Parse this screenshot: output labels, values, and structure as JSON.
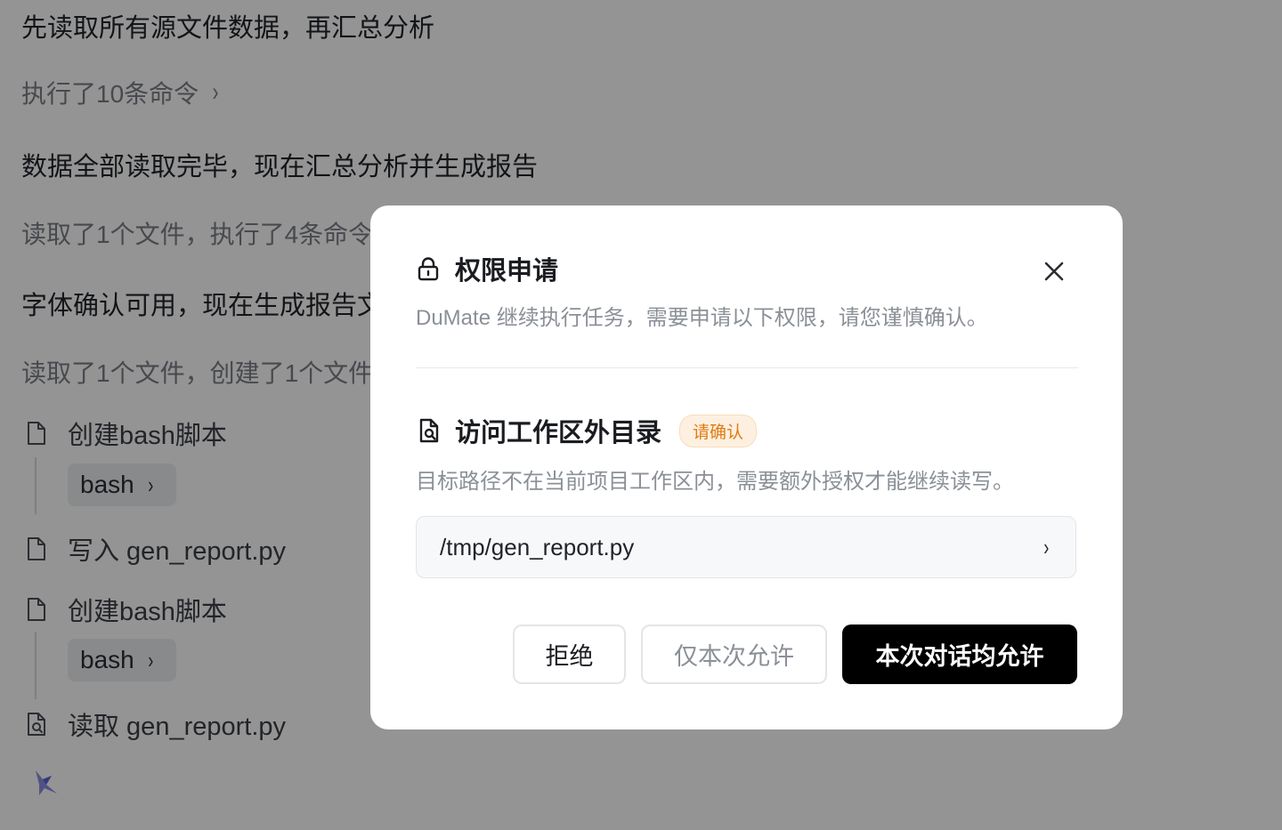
{
  "chat": {
    "msg1": "先读取所有源文件数据，再汇总分析",
    "summary1": "执行了10条命令",
    "msg2": "数据全部读取完毕，现在汇总分析并生成报告",
    "summary2": "读取了1个文件，执行了4条命令",
    "msg3": "字体确认可用，现在生成报告文",
    "summary3": "读取了1个文件，创建了1个文件",
    "steps": [
      {
        "label": "创建bash脚本",
        "tool": "bash"
      },
      {
        "label": "写入 gen_report.py"
      },
      {
        "label": "创建bash脚本",
        "tool": "bash"
      },
      {
        "label": "读取 gen_report.py"
      }
    ],
    "chevron": "›"
  },
  "modal": {
    "title": "权限申请",
    "description": "DuMate 继续执行任务，需要申请以下权限，请您谨慎确认。",
    "section": {
      "title": "访问工作区外目录",
      "badge": "请确认",
      "description": "目标路径不在当前项目工作区内，需要额外授权才能继续读写。",
      "path": "/tmp/gen_report.py"
    },
    "buttons": {
      "deny": "拒绝",
      "once": "仅本次允许",
      "all": "本次对话均允许"
    }
  },
  "icons": {
    "lock": "lock-icon",
    "close": "close-icon",
    "file_search": "file-search-icon",
    "file": "file-icon",
    "chevron": "chevron-right-icon",
    "spark": "sparkle-icon"
  },
  "colors": {
    "badge_text": "#e07b14",
    "badge_bg": "#fdf0e0",
    "primary_button": "#000000",
    "overlay": "rgba(0,0,0,0.42)"
  }
}
